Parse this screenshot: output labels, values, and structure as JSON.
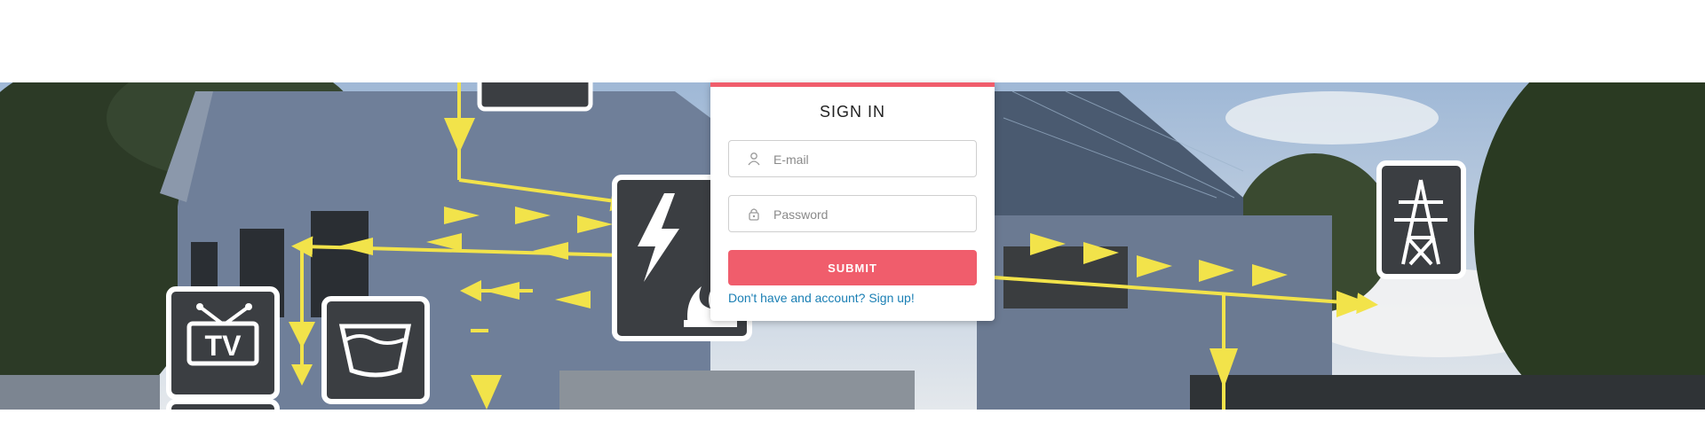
{
  "login": {
    "title": "SIGN IN",
    "email_placeholder": "E-mail",
    "password_placeholder": "Password",
    "submit_label": "SUBMIT",
    "signup_link": "Don't have and account? Sign up!"
  },
  "banner": {
    "tv_label": "TV",
    "icons": [
      "tv-icon",
      "washing-basin-icon",
      "lightning-heat-icon",
      "power-tower-icon"
    ]
  },
  "colors": {
    "accent": "#f05d6c",
    "link": "#1a7fb4",
    "flow_arrow": "#f2e34a",
    "icon_tile": "#3b3e42"
  }
}
